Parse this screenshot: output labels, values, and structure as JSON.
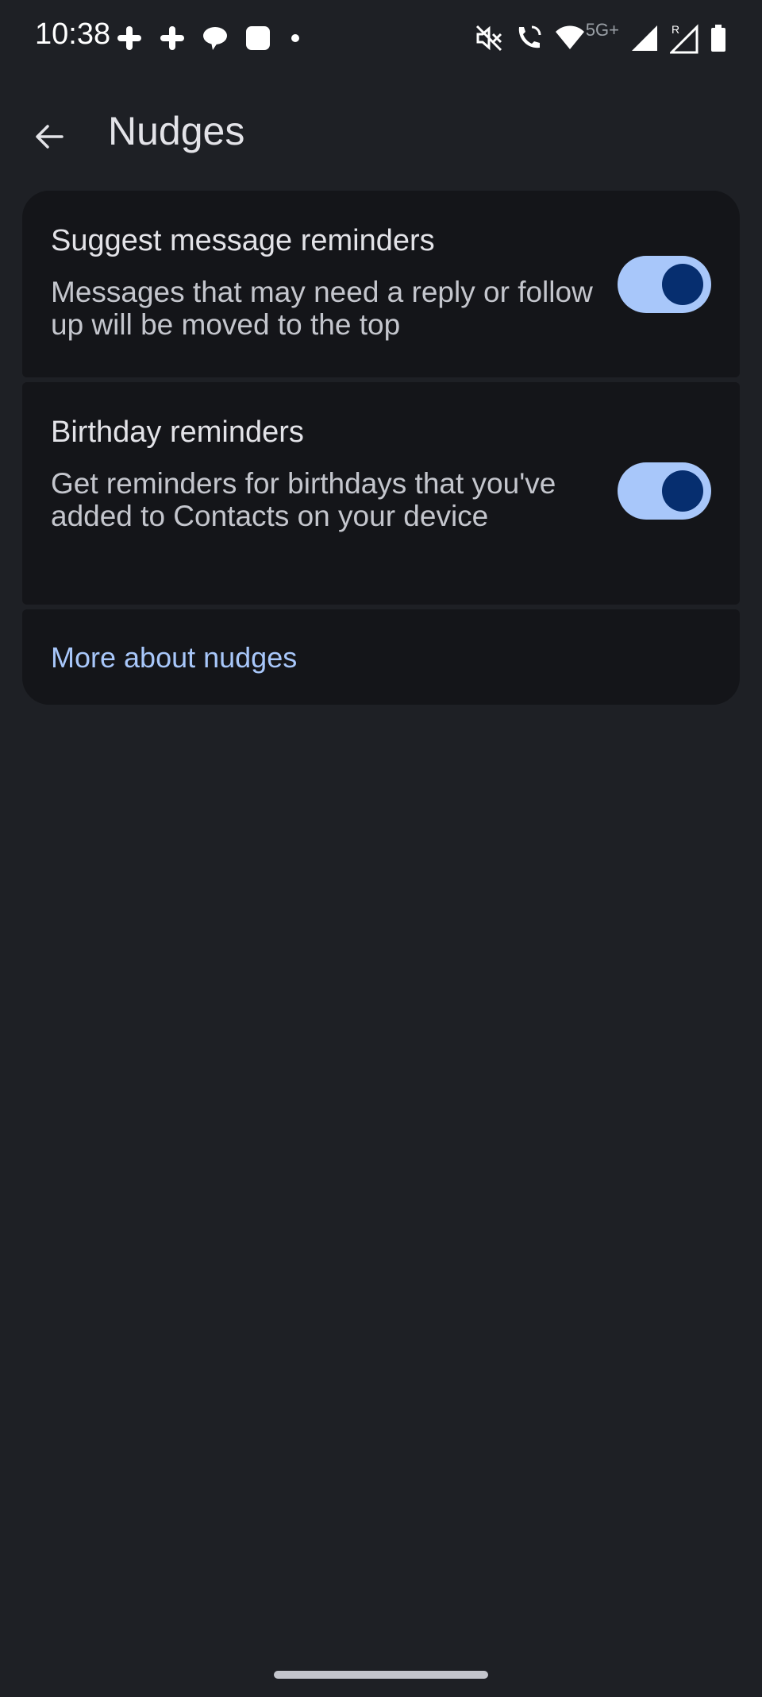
{
  "status_bar": {
    "time": "10:38",
    "left_icons": [
      "slack-icon",
      "slack-icon",
      "chat-bubble-icon",
      "square-app-icon",
      "dot-icon"
    ],
    "right_icons": [
      "mute-icon",
      "wifi-calling-icon",
      "wifi-icon",
      "signal-icon",
      "roaming-signal-icon",
      "battery-icon"
    ],
    "network": "5G+",
    "roaming": "R"
  },
  "app_bar": {
    "title": "Nudges",
    "back_icon": "arrow-back-icon"
  },
  "settings": [
    {
      "title": "Suggest message reminders",
      "description": "Messages that may need a reply or follow up will be moved to the top",
      "enabled": true
    },
    {
      "title": "Birthday reminders",
      "description": "Get reminders for birthdays that you've added to Contacts on your device",
      "enabled": true
    }
  ],
  "link": {
    "label": "More about nudges"
  },
  "colors": {
    "background": "#1e2025",
    "card": "#141519",
    "accent": "#a8c7fa",
    "toggle_knob": "#062e6f"
  }
}
